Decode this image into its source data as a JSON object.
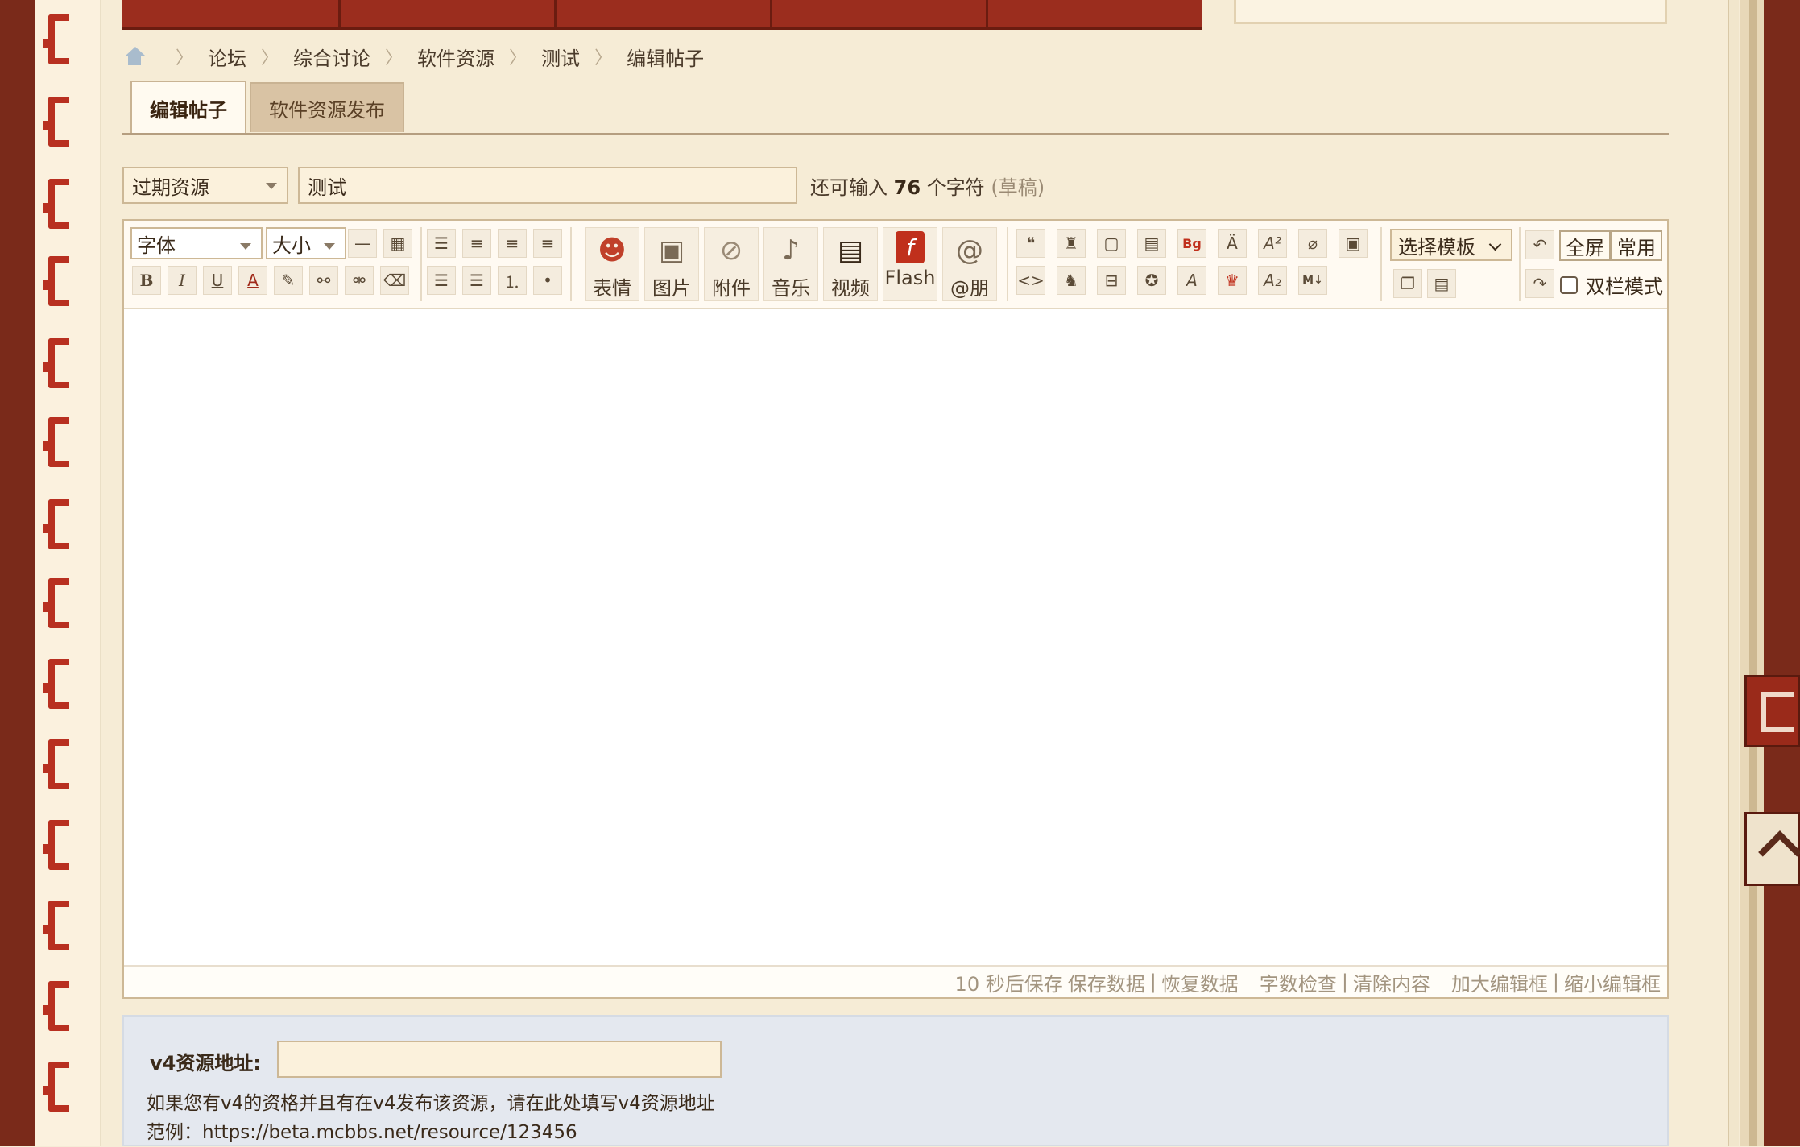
{
  "breadcrumb": [
    "论坛",
    "综合讨论",
    "软件资源",
    "测试",
    "编辑帖子"
  ],
  "tabs": [
    {
      "label": "编辑帖子",
      "active": true
    },
    {
      "label": "软件资源发布",
      "active": false
    }
  ],
  "post": {
    "category": "过期资源",
    "title": "测试",
    "counter_prefix": "还可输入",
    "counter_value": "76",
    "counter_suffix": "个字符",
    "draft_label": "(草稿)"
  },
  "toolbar": {
    "font_label": "字体",
    "size_label": "大小",
    "emoji_label": "表情",
    "image_label": "图片",
    "attach_label": "附件",
    "music_label": "音乐",
    "video_label": "视频",
    "flash_label": "Flash",
    "at_label": "@朋",
    "template_label": "选择模板",
    "fullscreen_label": "全屏",
    "common_label": "常用",
    "dual_mode_label": "双栏模式"
  },
  "status_bar": {
    "autosave": "10 秒后保存",
    "save": "保存数据",
    "restore": "恢复数据",
    "wordcheck": "字数检查",
    "clear": "清除内容",
    "enlarge": "加大编辑框",
    "shrink": "缩小编辑框",
    "separator": "|"
  },
  "v4": {
    "label": "v4资源地址:",
    "value": "",
    "hint1": "如果您有v4的资格并且有在v4发布该资源，请在此处填写v4资源地址",
    "hint2": "范例：https://beta.mcbbs.net/resource/123456"
  },
  "colors": {
    "frame_dark": "#7a2a1a",
    "accent_red": "#b83020",
    "page_bg": "#f6ecd6",
    "v4_bg": "#e4e8ef"
  }
}
